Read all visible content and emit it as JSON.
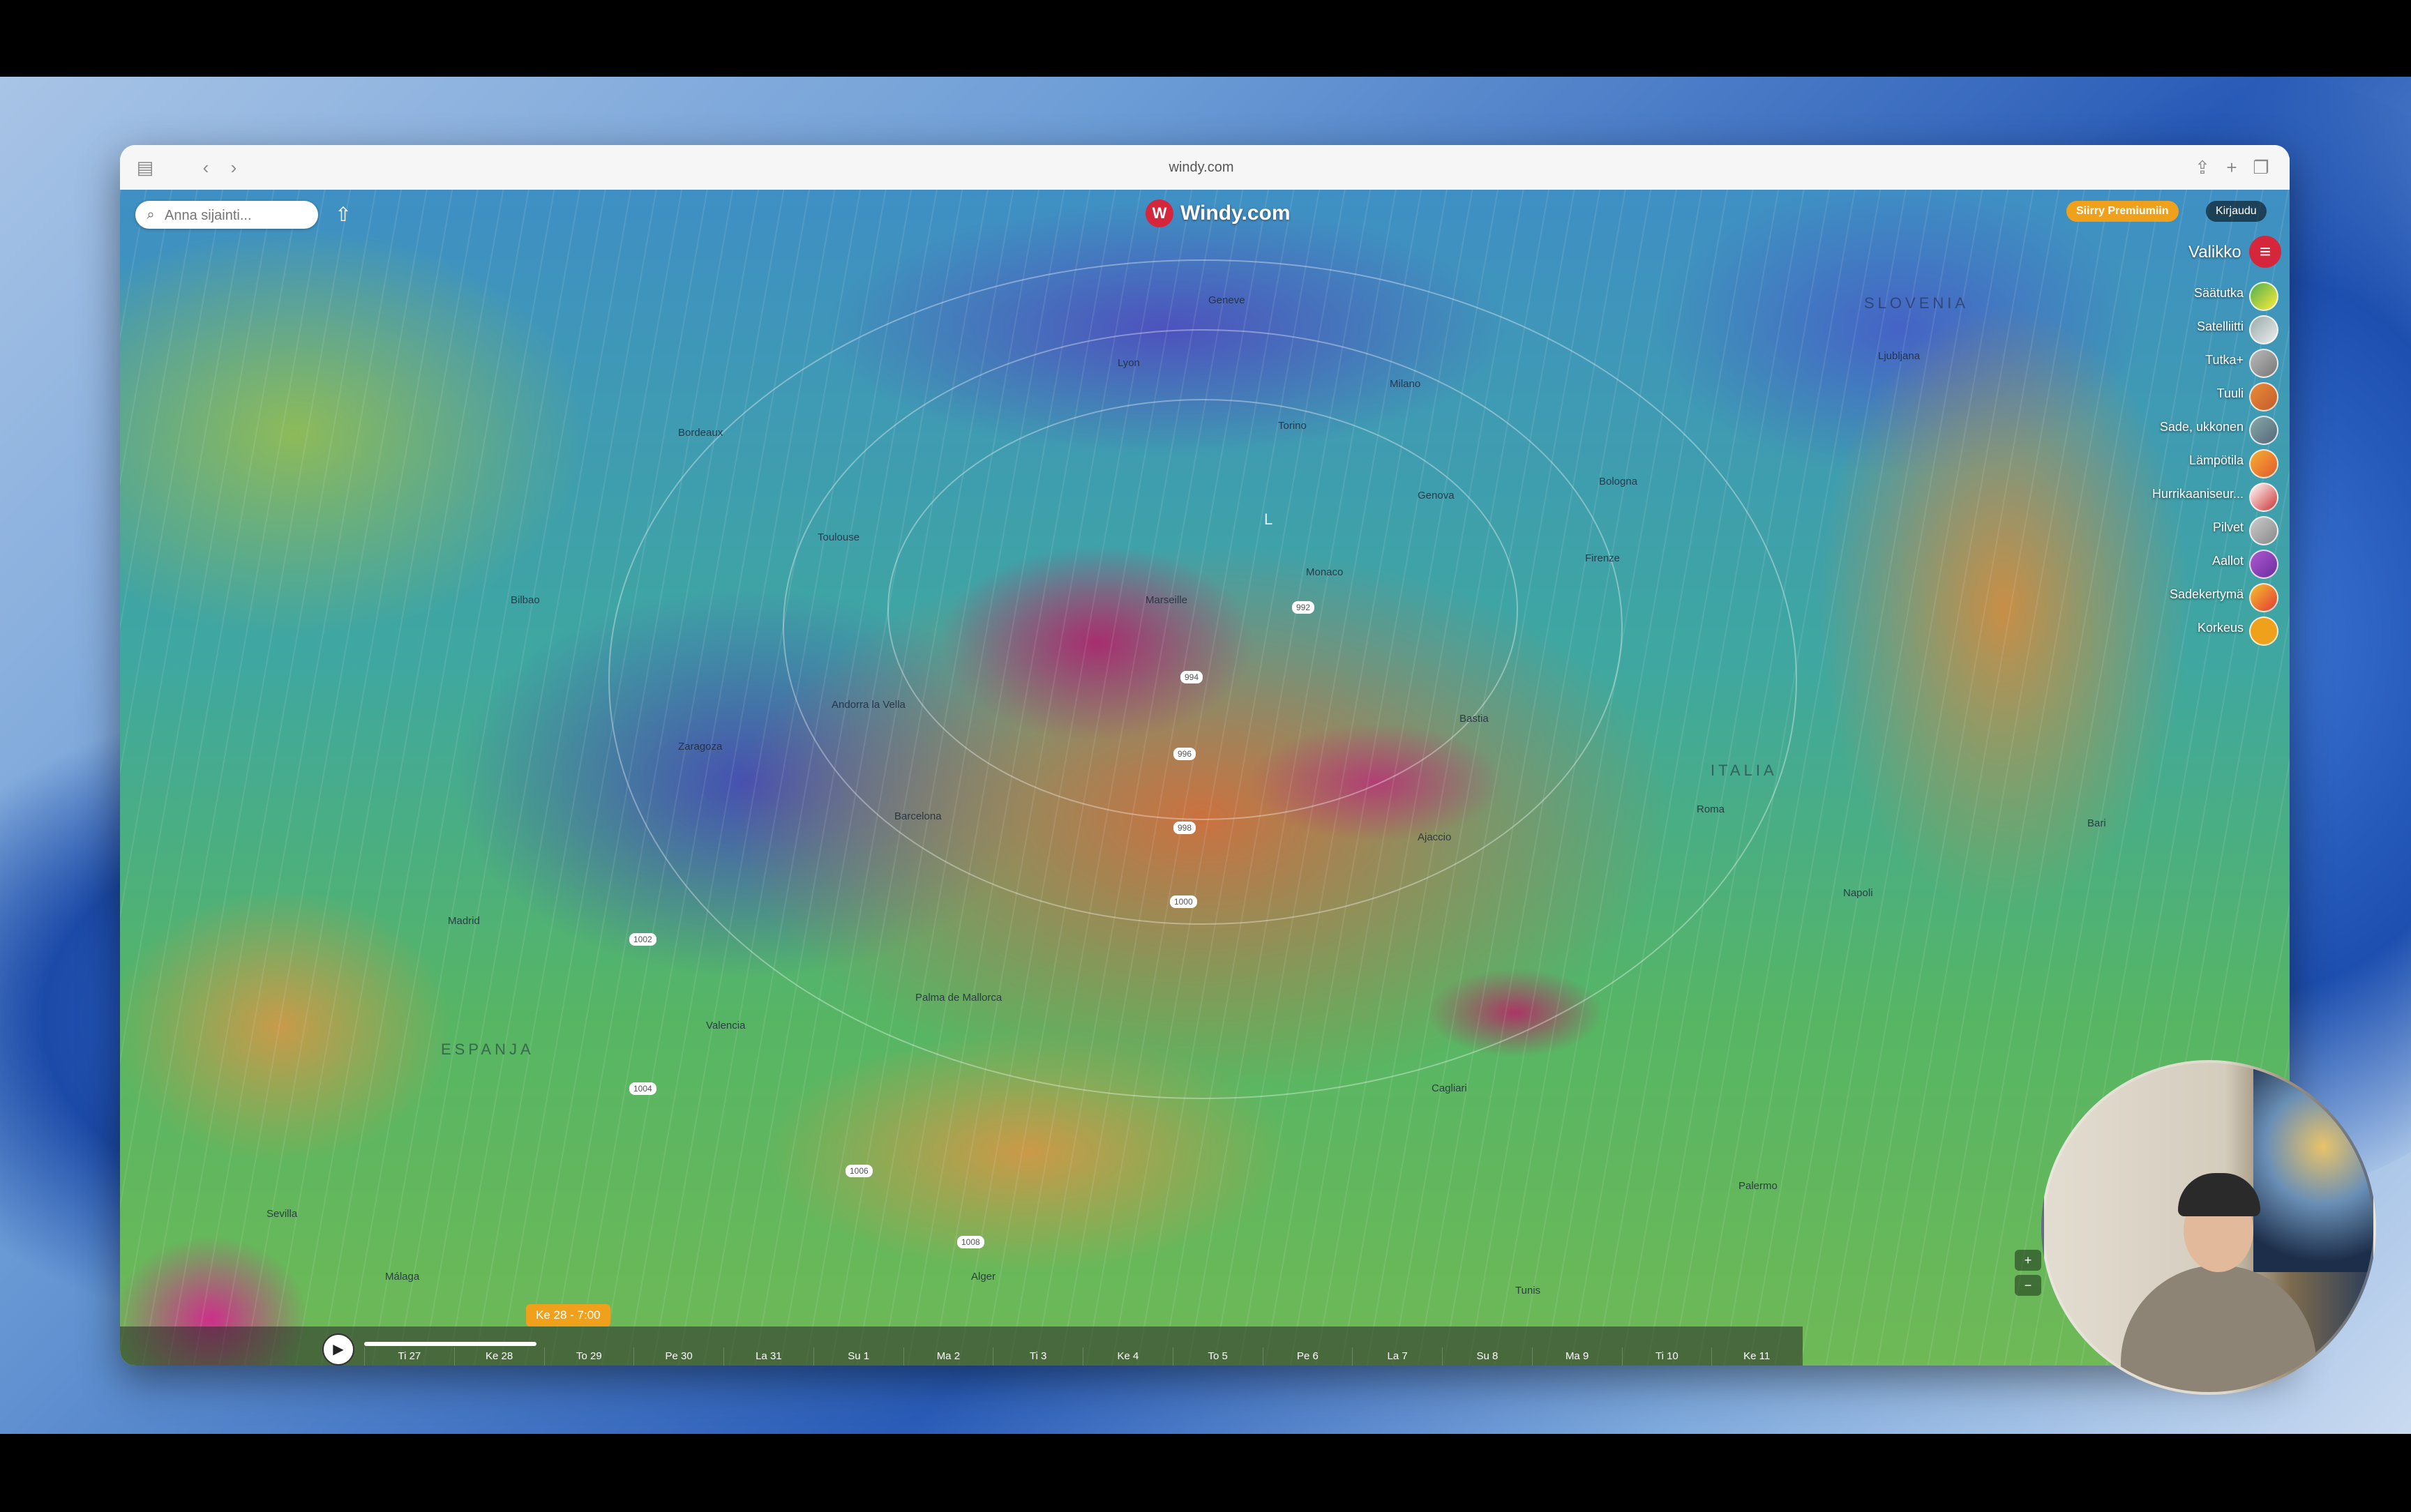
{
  "browser": {
    "url": "windy.com"
  },
  "app": {
    "brand": "Windy.com",
    "search_placeholder": "Anna sijainti...",
    "premium_label": "Siirry Premiumiin",
    "login_label": "Kirjaudu",
    "menu_label": "Valikko"
  },
  "layers": [
    {
      "label": "Säätutka",
      "icon": "radar-icon"
    },
    {
      "label": "Satelliitti",
      "icon": "satellite-icon"
    },
    {
      "label": "Tutka+",
      "icon": "radar-plus-icon"
    },
    {
      "label": "Tuuli",
      "icon": "wind-icon"
    },
    {
      "label": "Sade, ukkonen",
      "icon": "rain-icon"
    },
    {
      "label": "Lämpötila",
      "icon": "temperature-icon"
    },
    {
      "label": "Hurrikaaniseur...",
      "icon": "hurricane-icon"
    },
    {
      "label": "Pilvet",
      "icon": "clouds-icon"
    },
    {
      "label": "Aallot",
      "icon": "waves-icon"
    },
    {
      "label": "Sadekertymä",
      "icon": "rain-accumulation-icon"
    },
    {
      "label": "Korkeus",
      "icon": "altitude-icon"
    }
  ],
  "map": {
    "countries": [
      "ESPANJA",
      "ITALIA",
      "SLOVENIA"
    ],
    "cities": [
      "Geneve",
      "Lyon",
      "Torino",
      "Milano",
      "Genova",
      "Monaco",
      "Marseille",
      "Barcelona",
      "Andorra la Vella",
      "Madrid",
      "Valencia",
      "Palma de Mallorca",
      "Roma",
      "Napoli",
      "Bastia",
      "Ajaccio",
      "Cagliari",
      "Palermo",
      "Tunis",
      "Alger",
      "Málaga",
      "Sevilla",
      "Bordeaux",
      "Toulouse",
      "Bilbao",
      "Zaragoza",
      "Firenze",
      "Bologna",
      "Ljubljana",
      "Bari"
    ],
    "pressure_labels": [
      "992",
      "994",
      "996",
      "998",
      "1000",
      "1002",
      "1004",
      "1006",
      "1008"
    ],
    "low_marker": "L"
  },
  "timeline": {
    "current_time": "Ke 28 - 7:00",
    "days": [
      "Ti 27",
      "Ke 28",
      "To 29",
      "Pe 30",
      "La 31",
      "Su 1",
      "Ma 2",
      "Ti 3",
      "Ke 4",
      "To 5",
      "Pe 6",
      "La 7",
      "Su 8",
      "Ma 9",
      "Ti 10",
      "Ke 11"
    ],
    "progress": 0.12
  },
  "controls": [
    "+",
    "−"
  ]
}
